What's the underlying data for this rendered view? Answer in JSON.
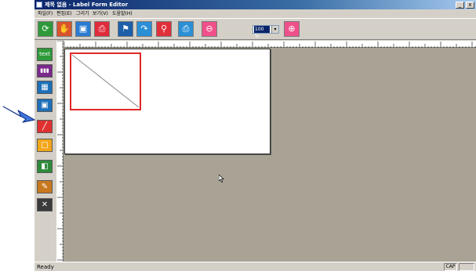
{
  "window": {
    "title": "제목 없음 - Label Form Editor",
    "minimize_glyph": "_",
    "close_glyph": "x"
  },
  "menu": [
    {
      "label": "파일(F)"
    },
    {
      "label": "편집(E)"
    },
    {
      "label": "그리기"
    },
    {
      "label": "보기(V)"
    },
    {
      "label": "도움말(H)"
    }
  ],
  "toolbar": {
    "zoom_value": "100 %",
    "zoom_arrow": "▾",
    "buttons": [
      {
        "name": "open-icon",
        "glyph": "⟳",
        "color": "#2e9a3a"
      },
      {
        "name": "hand-icon",
        "glyph": "✋",
        "color": "#d9542c"
      },
      {
        "name": "save-icon",
        "glyph": "▣",
        "color": "#2b7bd1"
      },
      {
        "name": "print-icon",
        "glyph": "⎙",
        "color": "#e02b3a"
      },
      {
        "name": "printer-settings-icon",
        "glyph": "⚑",
        "color": "#1d5fa8"
      },
      {
        "name": "redo-icon",
        "glyph": "↷",
        "color": "#2b8fd6"
      },
      {
        "name": "map-pin-icon",
        "glyph": "⚲",
        "color": "#e0303a"
      },
      {
        "name": "print-preview-icon",
        "glyph": "⎙",
        "color": "#2b8fd6"
      },
      {
        "name": "zoom-out-icon",
        "glyph": "⊖",
        "color": "#f0508a"
      },
      {
        "name": "zoom-in-icon",
        "glyph": "⊕",
        "color": "#f0508a"
      }
    ]
  },
  "tools": [
    {
      "name": "text-tool-icon",
      "glyph": "text",
      "color": "#2e9a3a"
    },
    {
      "name": "barcode-tool-icon",
      "glyph": "▮▮▮",
      "color": "#7a2a8a"
    },
    {
      "name": "qrcode-tool-icon",
      "glyph": "▦",
      "color": "#1d6fb8"
    },
    {
      "name": "image-tool-icon",
      "glyph": "▣",
      "color": "#1d6fb8"
    },
    {
      "name": "line-tool-icon",
      "glyph": "╱",
      "color": "#e03030"
    },
    {
      "name": "rectangle-tool-icon",
      "glyph": "□",
      "color": "#f2a71a"
    },
    {
      "name": "picture-tool-icon",
      "glyph": "◧",
      "color": "#2e8a3a"
    },
    {
      "name": "edit-tool-icon",
      "glyph": "✎",
      "color": "#c8781e"
    },
    {
      "name": "settings-tool-icon",
      "glyph": "✕",
      "color": "#3a3a3a"
    }
  ],
  "status": {
    "text": "Ready",
    "cap": "CAP"
  },
  "colors": {
    "canvas_background": "#a9a395",
    "selection_border": "#e02828",
    "pointer_arrow": "#3f76e0"
  }
}
